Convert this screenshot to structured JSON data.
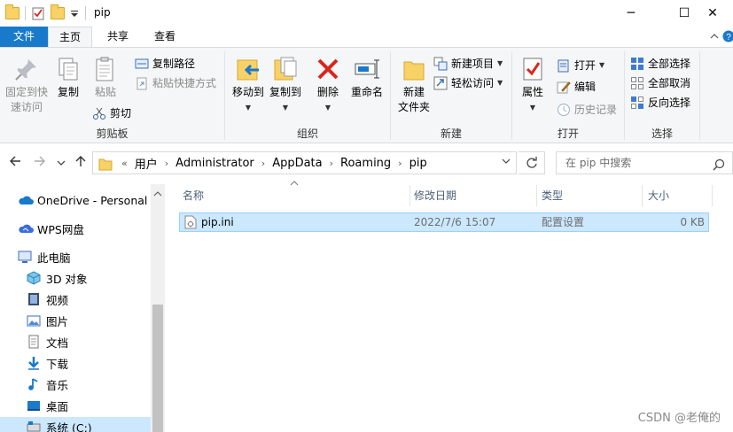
{
  "window": {
    "title": "pip",
    "minimize": "─",
    "maximize": "☐",
    "close": "✕"
  },
  "tabs": {
    "file": "文件",
    "home": "主页",
    "share": "共享",
    "view": "查看"
  },
  "ribbon": {
    "clipboard": {
      "pin_label_line1": "固定到快",
      "pin_label_line2": "速访问",
      "copy": "复制",
      "paste": "粘贴",
      "copy_path": "复制路径",
      "paste_shortcut": "粘贴快捷方式",
      "cut": "剪切",
      "group_label": "剪贴板"
    },
    "organize": {
      "move_to": "移动到",
      "copy_to": "复制到",
      "delete": "删除",
      "rename": "重命名",
      "group_label": "组织"
    },
    "new": {
      "new_folder_line1": "新建",
      "new_folder_line2": "文件夹",
      "new_item": "新建项目",
      "easy_access": "轻松访问",
      "group_label": "新建"
    },
    "open": {
      "properties": "属性",
      "open": "打开",
      "edit": "编辑",
      "history": "历史记录",
      "group_label": "打开"
    },
    "select": {
      "select_all": "全部选择",
      "select_none": "全部取消",
      "invert": "反向选择",
      "group_label": "选择"
    }
  },
  "address": {
    "prefix": "«",
    "segments": [
      "用户",
      "Administrator",
      "AppData",
      "Roaming",
      "pip"
    ],
    "search_placeholder": "在 pip 中搜索"
  },
  "navpane": {
    "items": [
      {
        "label": "OneDrive - Personal",
        "icon": "cloud-icon"
      },
      {
        "label": "WPS网盘",
        "icon": "wps-cloud-icon"
      },
      {
        "label": "此电脑",
        "icon": "computer-icon"
      },
      {
        "label": "3D 对象",
        "icon": "cube-icon"
      },
      {
        "label": "视频",
        "icon": "video-icon"
      },
      {
        "label": "图片",
        "icon": "picture-icon"
      },
      {
        "label": "文档",
        "icon": "document-icon"
      },
      {
        "label": "下载",
        "icon": "download-icon"
      },
      {
        "label": "音乐",
        "icon": "music-icon"
      },
      {
        "label": "桌面",
        "icon": "desktop-icon"
      },
      {
        "label": "系统 (C:)",
        "icon": "drive-icon"
      }
    ]
  },
  "columns": {
    "name": "名称",
    "modified": "修改日期",
    "type": "类型",
    "size": "大小"
  },
  "files": [
    {
      "name": "pip.ini",
      "modified": "2022/7/6 15:07",
      "type": "配置设置",
      "size": "0 KB"
    }
  ],
  "watermark": "CSDN @老俺的",
  "colors": {
    "accent": "#1979ca",
    "selection": "#cce8ff",
    "folder": "#f8d267",
    "delete_red": "#d9261c"
  }
}
